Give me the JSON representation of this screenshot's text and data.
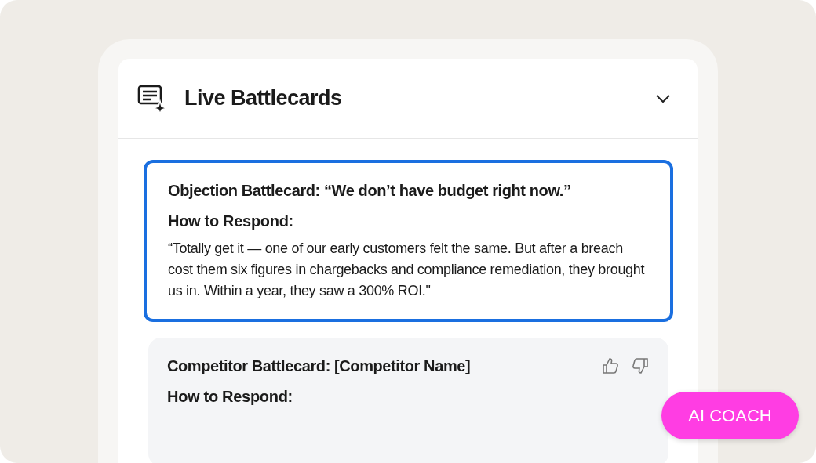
{
  "panel": {
    "title": "Live Battlecards",
    "expanded": true
  },
  "cards": [
    {
      "title": "Objection Battlecard: “We don’t have budget right now.”",
      "subtitle": "How to Respond:",
      "body": "“Totally get it — one of our early customers felt the same. But after a breach cost them six figures in chargebacks and compliance remediation, they brought us in. Within a year, they saw a 300% ROI.\"",
      "selected": true,
      "feedback": false
    },
    {
      "title": "Competitor Battlecard: [Competitor Name]",
      "subtitle": "How to Respond:",
      "selected": false,
      "feedback": true
    }
  ],
  "badge": "AI COACH"
}
